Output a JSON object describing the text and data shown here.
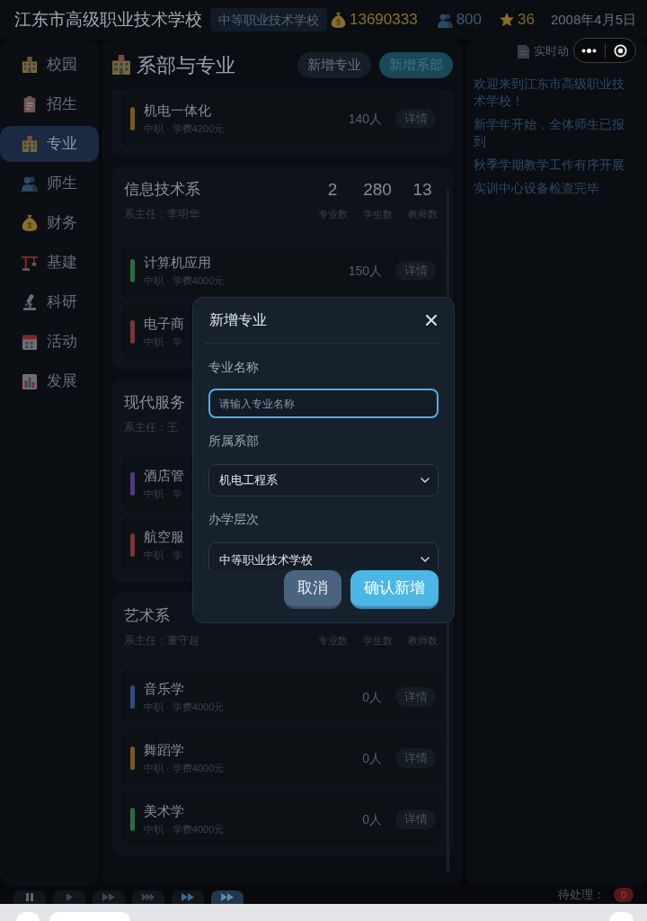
{
  "header": {
    "title": "江东市高级职业技术学校",
    "badge": "中等职业技术学校",
    "stats": [
      "13690333",
      "800",
      "36"
    ],
    "date": "2008年4月5日"
  },
  "sidebar": {
    "items": [
      {
        "label": "校园",
        "selected": false
      },
      {
        "label": "招生",
        "selected": false
      },
      {
        "label": "专业",
        "selected": true
      },
      {
        "label": "师生",
        "selected": false
      },
      {
        "label": "财务",
        "selected": false
      },
      {
        "label": "基建",
        "selected": false
      },
      {
        "label": "科研",
        "selected": false
      },
      {
        "label": "活动",
        "selected": false
      },
      {
        "label": "发展",
        "selected": false
      }
    ]
  },
  "page": {
    "title": "系部与专业",
    "buttons": [
      {
        "label": "新增专业",
        "kind": "secondary"
      },
      {
        "label": "新增系部",
        "kind": "primary"
      }
    ],
    "departments": [
      {
        "majors": [
          {
            "name": "机电一体化",
            "info": "中职 · 学费4200元",
            "students": "140人",
            "action": "详情",
            "color": "#7a5a24"
          }
        ]
      },
      {
        "name": "信息技术系",
        "head": "系主任：李明华",
        "stats": [
          {
            "value": "2",
            "label": "专业数"
          },
          {
            "value": "280",
            "label": "学生数"
          },
          {
            "value": "13",
            "label": "教师数"
          }
        ],
        "majors": [
          {
            "name": "计算机应用",
            "info": "中职 · 学费4000元",
            "students": "150人",
            "action": "详情",
            "color": "#2f6a40"
          },
          {
            "name": "电子商",
            "info": "中职 · 学",
            "color": "#7a3636"
          }
        ]
      },
      {
        "name": "现代服务",
        "head": "系主任：王",
        "majors": [
          {
            "name": "酒店管",
            "info": "中职 · 学",
            "color": "#54397a"
          },
          {
            "name": "航空服",
            "info": "中职 · 学",
            "color": "#7a3636"
          }
        ]
      },
      {
        "name": "艺术系",
        "head": "系主任：董守超",
        "stats": [
          {
            "label": "专业数"
          },
          {
            "label": "学生数"
          },
          {
            "label": "教师数"
          }
        ],
        "majors": [
          {
            "name": "音乐学",
            "info": "中职 · 学费4000元",
            "students": "0人",
            "action": "详情",
            "color": "#2f4f7a"
          },
          {
            "name": "舞蹈学",
            "info": "中职 · 学费4000元",
            "students": "0人",
            "action": "详情",
            "color": "#7a5a24"
          },
          {
            "name": "美术学",
            "info": "中职 · 学费4000元",
            "students": "0人",
            "action": "详情",
            "color": "#2f6a40"
          }
        ]
      }
    ]
  },
  "news": {
    "title": "实时动",
    "items": [
      "欢迎来到江东市高级职业技术学校！",
      "新学年开始，全体师生已报到",
      "秋季学期教学工作有序开展",
      "实训中心设备检查完毕"
    ]
  },
  "bottom_bar": {
    "controls": [
      {
        "kind": "pause",
        "selected": false
      },
      {
        "kind": "play",
        "selected": false
      },
      {
        "kind": "play2",
        "selected": false
      },
      {
        "kind": "play3",
        "selected": false
      },
      {
        "kind": "forward",
        "selected": false
      },
      {
        "kind": "forward2",
        "selected": true
      }
    ],
    "pending_label": "待处理：",
    "pending_count": "0"
  },
  "dialog": {
    "title": "新增专业",
    "fields": [
      {
        "kind": "text",
        "label": "专业名称",
        "placeholder": "请输入专业名称",
        "focused": true
      },
      {
        "kind": "select",
        "label": "所属系部",
        "value": "机电工程系"
      },
      {
        "kind": "select",
        "label": "办学层次",
        "value": "中等职业技术学校"
      }
    ],
    "buttons": [
      {
        "label": "取消",
        "kind": "secondary"
      },
      {
        "label": "确认新增",
        "kind": "primary"
      }
    ]
  }
}
